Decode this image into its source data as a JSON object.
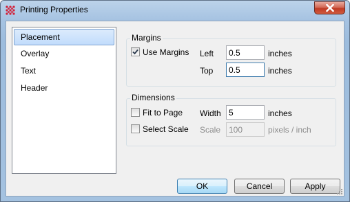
{
  "window": {
    "title": "Printing Properties",
    "app_icon": "grid-app-icon",
    "close_icon": "close-icon"
  },
  "sidebar": {
    "items": [
      {
        "label": "Placement",
        "selected": true
      },
      {
        "label": "Overlay",
        "selected": false
      },
      {
        "label": "Text",
        "selected": false
      },
      {
        "label": "Header",
        "selected": false
      }
    ]
  },
  "margins": {
    "group_label": "Margins",
    "use_margins_label": "Use Margins",
    "use_margins_checked": true,
    "left_label": "Left",
    "left_value": "0.5",
    "left_unit": "inches",
    "top_label": "Top",
    "top_value": "0.5",
    "top_unit": "inches"
  },
  "dimensions": {
    "group_label": "Dimensions",
    "fit_to_page_label": "Fit to Page",
    "fit_to_page_checked": false,
    "width_label": "Width",
    "width_value": "5",
    "width_unit": "inches",
    "select_scale_label": "Select Scale",
    "select_scale_checked": false,
    "scale_label": "Scale",
    "scale_value": "100",
    "scale_unit": "pixels / inch"
  },
  "buttons": {
    "ok": "OK",
    "cancel": "Cancel",
    "apply": "Apply"
  }
}
